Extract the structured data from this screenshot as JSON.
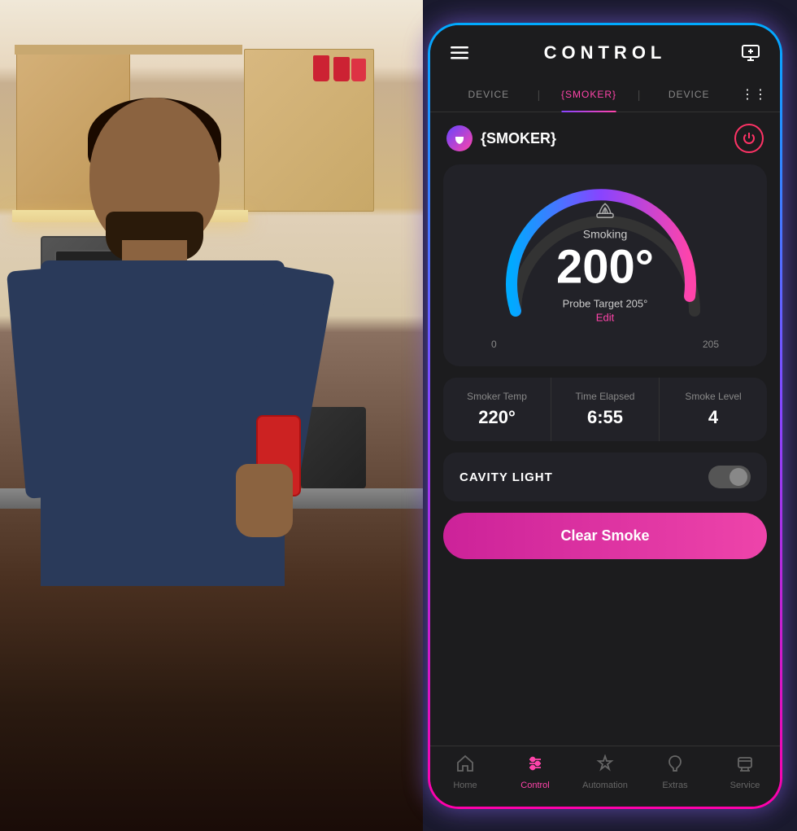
{
  "photo": {
    "alt": "Man smiling looking at phone in modern kitchen"
  },
  "app": {
    "header": {
      "menu_icon": "☰",
      "title": "CONTROL",
      "add_icon": "⊞"
    },
    "tabs": [
      {
        "label": "DEVICE",
        "active": false
      },
      {
        "label": "{SMOKER}",
        "active": true
      },
      {
        "label": "DEVICE",
        "active": false
      }
    ],
    "device": {
      "name": "{SMOKER}",
      "power_state": "on"
    },
    "gauge": {
      "current_temp": "200°",
      "mode_icon": "☁",
      "mode_label": "Smoking",
      "probe_target_label": "Probe Target 205°",
      "edit_label": "Edit",
      "scale_min": "0",
      "scale_max": "205",
      "arc_start_angle": 220,
      "arc_end_angle": 320
    },
    "stats": [
      {
        "label": "Smoker Temp",
        "value": "220°"
      },
      {
        "label": "Time Elapsed",
        "value": "6:55"
      },
      {
        "label": "Smoke Level",
        "value": "4"
      }
    ],
    "cavity_light": {
      "label": "CAVITY LIGHT",
      "enabled": false
    },
    "clear_smoke_button": "Clear Smoke",
    "bottom_nav": [
      {
        "icon": "🏠",
        "label": "Home",
        "active": false
      },
      {
        "icon": "⚙",
        "label": "Control",
        "active": true
      },
      {
        "icon": "⚡",
        "label": "Automation",
        "active": false
      },
      {
        "icon": "🎁",
        "label": "Extras",
        "active": false
      },
      {
        "icon": "🔧",
        "label": "Service",
        "active": false
      }
    ]
  },
  "colors": {
    "accent_pink": "#ff44aa",
    "accent_blue": "#00aaff",
    "accent_purple": "#8844ff",
    "bg_dark": "#1c1c1e",
    "bg_card": "#222228",
    "gauge_start": "#8844ff",
    "gauge_end": "#00aaff"
  }
}
